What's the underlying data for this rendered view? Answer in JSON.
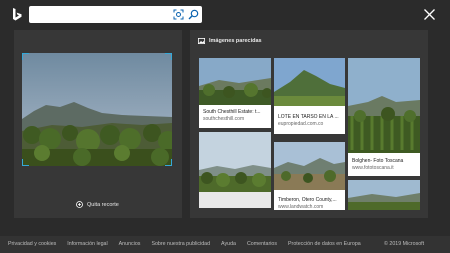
{
  "search": {
    "value": ""
  },
  "crop_label": "Quita recorte",
  "results_title": "Imágenes parecidas",
  "results": [
    {
      "caption": "South Chesthill Estate: t...",
      "source": "southchesthill.com"
    },
    {
      "caption": "LOTE EN TARSO EN LA ...",
      "source": "eupropiedad.com.co"
    },
    {
      "caption": "Bolghen- Foto Toscana",
      "source": "www.fototoscana.it"
    },
    {
      "caption": "",
      "source": ""
    },
    {
      "caption": "Timberon, Otero County,...",
      "source": "www.landwatch.com"
    },
    {
      "caption": "",
      "source": ""
    }
  ],
  "footer": {
    "links": [
      "Privacidad y cookies",
      "Información legal",
      "Anuncios",
      "Sobre nuestra publicidad",
      "Ayuda",
      "Comentarios",
      "Protección de datos en Europa"
    ],
    "copyright": "© 2019 Microsoft"
  },
  "colors": {
    "accent": "#35a8d8",
    "background": "#2b2b2b",
    "panel": "#373737"
  }
}
